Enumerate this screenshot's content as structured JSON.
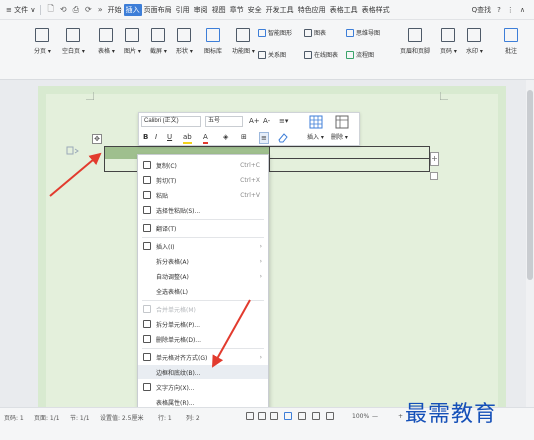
{
  "menubar": {
    "file": "≡ 文件 ∨",
    "quick_icons": [
      "🗋",
      "⟲",
      "⎙",
      "⟳",
      "»"
    ],
    "tabs": [
      "开始",
      "插入",
      "页面布局",
      "引用",
      "审阅",
      "视图",
      "章节",
      "安全",
      "开发工具",
      "特色应用",
      "表格工具",
      "表格样式"
    ],
    "active_tab": "插入",
    "search": "Q查找",
    "help": "?",
    "more": "⋮",
    "collapse": "∧"
  },
  "ribbon": {
    "cover_page": "分页 ▾",
    "blank_page": "空白页 ▾",
    "table": "表格 ▾",
    "picture": "图片 ▾",
    "screenshot": "截屏 ▾",
    "shapes": "形状 ▾",
    "icon_library": "图标库",
    "function_chart": "功能图 ▾",
    "smart_graphic": "智能图形",
    "chart": "图表",
    "mind_map": "思维导图",
    "relation_chart": "关系图",
    "online_chart": "在线图表",
    "flowchart": "流程图",
    "header_footer": "页眉和页脚",
    "page_number": "页码 ▾",
    "watermark": "水印 ▾",
    "comment": "批注"
  },
  "float_toolbar": {
    "font_name": "Calibri (正文)",
    "font_size": "五号",
    "grow_font": "A+",
    "shrink_font": "A-",
    "line_spacing": "≡▾",
    "bold": "B",
    "italic": "I",
    "underline": "U",
    "highlight": "ab",
    "font_color": "A",
    "shading": "◈",
    "borders": "⊞",
    "align": "≡",
    "insert": "插入 ▾",
    "delete": "删除 ▾"
  },
  "table_handles": {
    "move": "✥",
    "add": "+"
  },
  "context_menu": {
    "items": [
      {
        "label": "复制(C)",
        "shortcut": "Ctrl+C"
      },
      {
        "label": "剪切(T)",
        "shortcut": "Ctrl+X"
      },
      {
        "label": "粘贴",
        "shortcut": "Ctrl+V"
      },
      {
        "label": "选择性粘贴(S)..."
      },
      {
        "label": "翻译(T)"
      },
      {
        "label": "插入(I)"
      },
      {
        "label": "拆分表格(A)"
      },
      {
        "label": "自动调整(A)"
      },
      {
        "label": "全选表格(L)"
      },
      {
        "label": "合并单元格(M)"
      },
      {
        "label": "拆分单元格(P)..."
      },
      {
        "label": "删除单元格(D)..."
      },
      {
        "label": "单元格对齐方式(G)"
      },
      {
        "label": "边框和底纹(B)..."
      },
      {
        "label": "文字方向(X)..."
      },
      {
        "label": "表格属性(R)..."
      }
    ]
  },
  "statusbar": {
    "page": "页码: 1",
    "pages": "页面: 1/1",
    "section": "节: 1/1",
    "setting": "设置值: 2.5厘米",
    "row": "行: 1",
    "col": "列: 2",
    "zoom": "100%",
    "zoom_minus": "—",
    "zoom_plus": "+"
  },
  "watermark_text": "最需教育",
  "colors": {
    "accent": "#3d7ed8",
    "page": "#e4f0dc",
    "selection": "#9fbf8e",
    "arrow": "#e23b2e",
    "watermark": "#1550b8"
  }
}
